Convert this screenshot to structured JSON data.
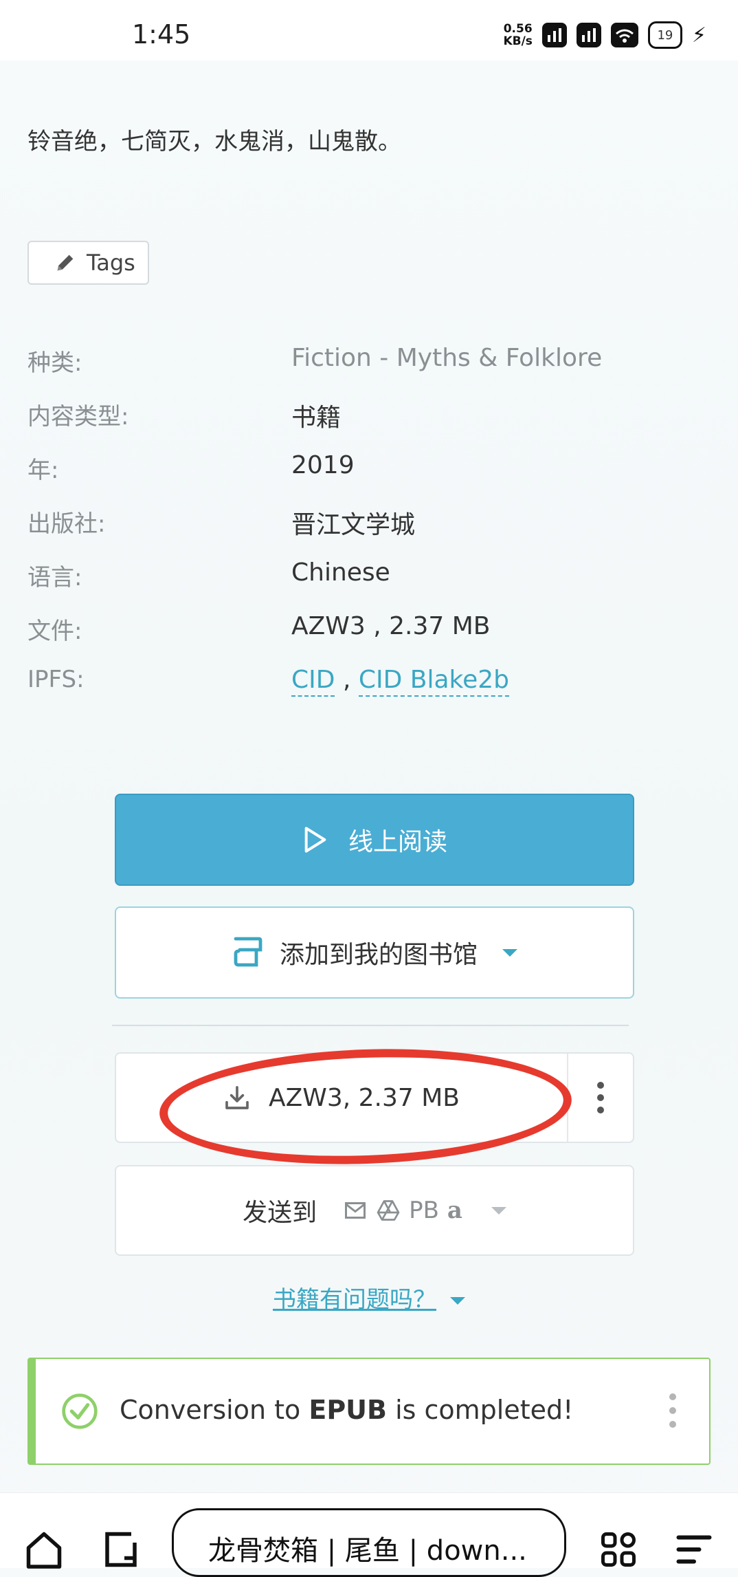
{
  "status_bar": {
    "time": "1:45",
    "net_speed_value": "0.56",
    "net_speed_unit": "KB/s",
    "battery": "19"
  },
  "description": "铃音绝，七简灭，水鬼消，山鬼散。",
  "tags_label": "Tags",
  "meta": [
    {
      "label": "种类:",
      "value": "Fiction - Myths & Folklore"
    },
    {
      "label": "内容类型:",
      "value": "书籍"
    },
    {
      "label": "年:",
      "value": "2019"
    },
    {
      "label": "出版社:",
      "value": "晋江文学城"
    },
    {
      "label": "语言:",
      "value": "Chinese"
    },
    {
      "label": "文件:",
      "value": "AZW3 , 2.37 MB"
    },
    {
      "label": "IPFS:",
      "links": [
        "CID",
        "CID Blake2b"
      ],
      "separator": ","
    }
  ],
  "read_online_label": "线上阅读",
  "add_library_label": "添加到我的图书馆",
  "download_label": "AZW3, 2.37 MB",
  "send_to_label": "发送到",
  "send_to_pb": "PB",
  "send_to_amazon": "a",
  "problem_link": "书籍有问题吗？",
  "notice": {
    "prefix": "Conversion to ",
    "format": "EPUB",
    "suffix": " is completed!"
  },
  "browser": {
    "url_title": "龙骨焚箱 | 尾鱼 | down..."
  },
  "colors": {
    "accent": "#4aadd4",
    "link": "#3aa7c3",
    "success": "#8ed06a",
    "annotation": "#e63a2e"
  }
}
